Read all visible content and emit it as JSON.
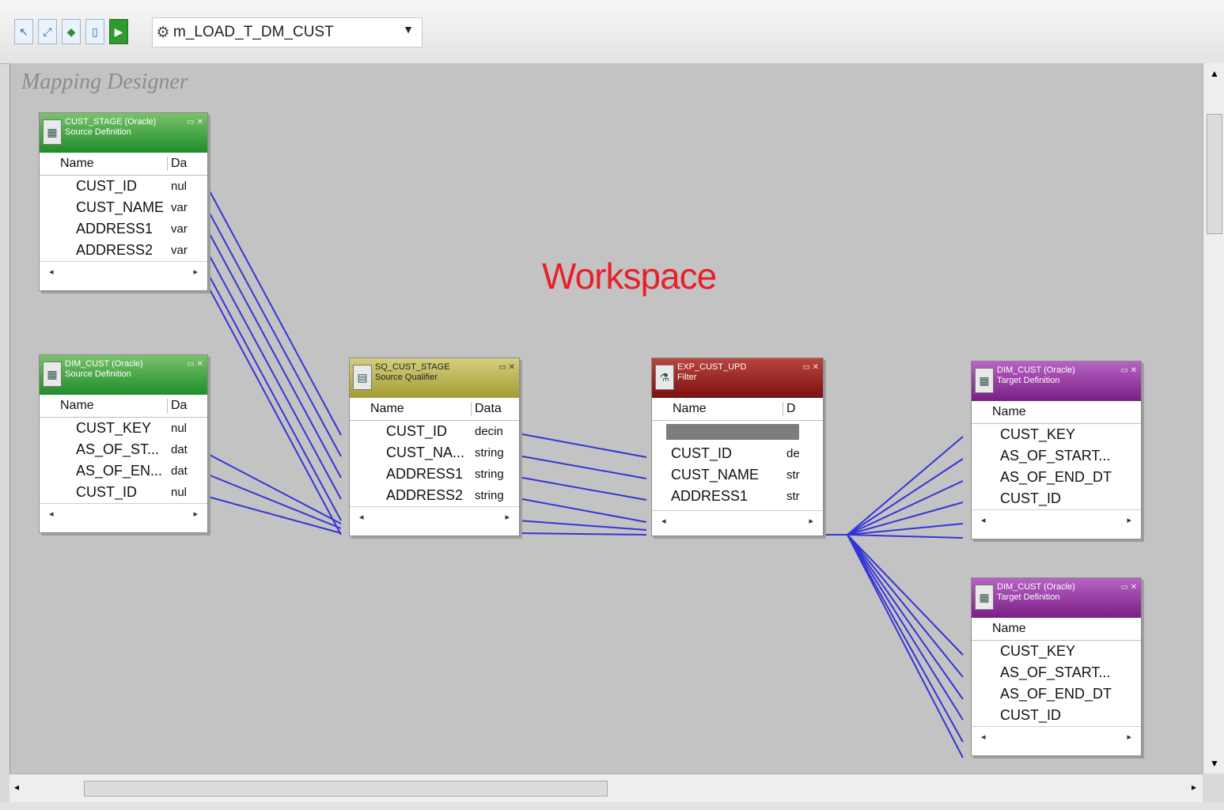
{
  "toolbar": {
    "icons": [
      "pointer-icon",
      "link-icon",
      "cube-icon",
      "page-icon",
      "run-icon"
    ],
    "mapping_selector": "m_LOAD_T_DM_CUST"
  },
  "workspace": {
    "layout_title": "Mapping Designer",
    "label": "Workspace"
  },
  "nodes": {
    "source1": {
      "title": "CUST_STAGE (Oracle)",
      "subtitle": "Source Definition",
      "col1": "Name",
      "col2": "Da",
      "rows": [
        [
          "CUST_ID",
          "nul"
        ],
        [
          "CUST_NAME",
          "var"
        ],
        [
          "ADDRESS1",
          "var"
        ],
        [
          "ADDRESS2",
          "var"
        ]
      ]
    },
    "source2": {
      "title": "DIM_CUST (Oracle)",
      "subtitle": "Source Definition",
      "col1": "Name",
      "col2": "Da",
      "rows": [
        [
          "CUST_KEY",
          "nul"
        ],
        [
          "AS_OF_ST...",
          "dat"
        ],
        [
          "AS_OF_EN...",
          "dat"
        ],
        [
          "CUST_ID",
          "nul"
        ]
      ]
    },
    "sq": {
      "title": "SQ_CUST_STAGE",
      "subtitle": "Source Qualifier",
      "col1": "Name",
      "col2": "Data",
      "rows": [
        [
          "CUST_ID",
          "decin"
        ],
        [
          "CUST_NA...",
          "string"
        ],
        [
          "ADDRESS1",
          "string"
        ],
        [
          "ADDRESS2",
          "string"
        ]
      ]
    },
    "xform": {
      "title": "EXP_CUST_UPD",
      "subtitle": "Filter",
      "col1": "Name",
      "col2": "D",
      "rows": [
        [
          "CUST_ID",
          "de"
        ],
        [
          "CUST_NAME",
          "str"
        ],
        [
          "ADDRESS1",
          "str"
        ]
      ]
    },
    "target1": {
      "title": "DIM_CUST (Oracle)",
      "subtitle": "Target Definition",
      "col1": "Name",
      "rows": [
        "CUST_KEY",
        "AS_OF_START...",
        "AS_OF_END_DT",
        "CUST_ID"
      ]
    },
    "target2": {
      "title": "DIM_CUST (Oracle)",
      "subtitle": "Target Definition",
      "col1": "Name",
      "rows": [
        "CUST_KEY",
        "AS_OF_START...",
        "AS_OF_END_DT",
        "CUST_ID"
      ]
    }
  },
  "colors": {
    "link": "#3535d6",
    "workspace": "#c3c3c3",
    "label": "#e8202a"
  }
}
